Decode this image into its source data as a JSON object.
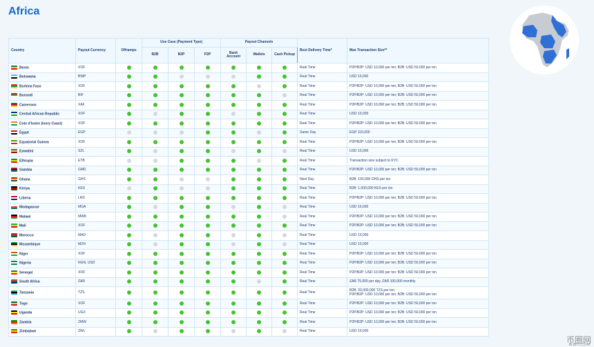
{
  "title": "Africa",
  "headers": {
    "country": "Country",
    "currency": "Payout Currency",
    "offramps": "Offramps",
    "use_case": "Use Case (Payment Type)",
    "b2b": "B2B",
    "b2p": "B2P",
    "p2p": "P2P",
    "payout_channels": "Payout Channels",
    "bank": "Bank Account",
    "wallets": "Wallets",
    "cash": "Cash Pickup",
    "delivery": "Best Delivery Time*",
    "max_txn": "Max Transaction Size**"
  },
  "status_colors": {
    "on": "#43c22f",
    "off": "#d4d8dc"
  },
  "rows": [
    {
      "country": "Benin",
      "currency": "XOF",
      "flag": [
        "#008751",
        "#fcd116",
        "#e8112d"
      ],
      "dots": [
        1,
        1,
        1,
        1,
        1,
        1,
        1
      ],
      "delivery": "Real Time",
      "max": "P2P/B2P: USD 10,000 per txn; B2B: USD 50,000 per txn"
    },
    {
      "country": "Botswana",
      "currency": "BWP",
      "flag": [
        "#75aadb",
        "#ffffff",
        "#000000"
      ],
      "dots": [
        1,
        1,
        0,
        0,
        0,
        1,
        1
      ],
      "delivery": "Real Time",
      "max": "USD 10,000"
    },
    {
      "country": "Burkina Faso",
      "currency": "XOF",
      "flag": [
        "#ef2b2d",
        "#009e49",
        "#fcd116"
      ],
      "dots": [
        1,
        1,
        1,
        1,
        1,
        0,
        1
      ],
      "delivery": "Real Time",
      "max": "P2P/B2P: USD 10,000 per txn; B2B: USD 50,000 per txn"
    },
    {
      "country": "Burundi",
      "currency": "BIF",
      "flag": [
        "#ce1126",
        "#1eb53a",
        "#ffffff"
      ],
      "dots": [
        1,
        1,
        1,
        1,
        1,
        1,
        0
      ],
      "delivery": "Real Time",
      "max": "P2P/B2P: USD 10,000 per txn; B2B: USD 50,000 per txn"
    },
    {
      "country": "Cameroon",
      "currency": "XAF",
      "flag": [
        "#007a5e",
        "#ce1126",
        "#fcd116"
      ],
      "dots": [
        1,
        1,
        1,
        1,
        1,
        1,
        1
      ],
      "delivery": "Real Time",
      "max": "P2P/B2P: USD 10,000 per txn; B2B: USD 50,000 per txn"
    },
    {
      "country": "Central African Republic",
      "currency": "XOF",
      "flag": [
        "#003082",
        "#ffffff",
        "#289728"
      ],
      "dots": [
        1,
        0,
        1,
        1,
        0,
        1,
        1
      ],
      "delivery": "Real Time",
      "max": "USD 10,000"
    },
    {
      "country": "Cote d'Ivoire (Ivory Coast)",
      "currency": "XOF",
      "flag": [
        "#f77f00",
        "#ffffff",
        "#009e60"
      ],
      "dots": [
        1,
        1,
        1,
        1,
        1,
        1,
        1
      ],
      "delivery": "Real Time",
      "max": "P2P/B2P: USD 10,000 per txn; B2B: USD 50,000 per txn"
    },
    {
      "country": "Egypt",
      "currency": "EGP",
      "flag": [
        "#ce1126",
        "#ffffff",
        "#000000"
      ],
      "dots": [
        0,
        0,
        0,
        1,
        1,
        0,
        1
      ],
      "delivery": "Same Day",
      "max": "EGP 110,000"
    },
    {
      "country": "Equatorial Guinea",
      "currency": "XOF",
      "flag": [
        "#3e9a00",
        "#ffffff",
        "#e32118"
      ],
      "dots": [
        1,
        1,
        1,
        1,
        1,
        1,
        1
      ],
      "delivery": "Real Time",
      "max": "P2P/B2P: USD 10,000 per txn; B2B: USD 50,000 per txn"
    },
    {
      "country": "Eswatini",
      "currency": "SZL",
      "flag": [
        "#3e5eb9",
        "#ffd900",
        "#b10c0c"
      ],
      "dots": [
        1,
        0,
        1,
        1,
        0,
        1,
        0
      ],
      "delivery": "Real Time",
      "max": "USD 10,000"
    },
    {
      "country": "Ethiopia",
      "currency": "ETB",
      "flag": [
        "#078930",
        "#fcdd09",
        "#da121a"
      ],
      "dots": [
        0,
        0,
        1,
        1,
        1,
        0,
        1
      ],
      "delivery": "Real Time",
      "max": "Transaction size subject to KYC"
    },
    {
      "country": "Gambia",
      "currency": "GMD",
      "flag": [
        "#ce1126",
        "#0c1c8c",
        "#3a7728"
      ],
      "dots": [
        1,
        1,
        1,
        1,
        1,
        1,
        1
      ],
      "delivery": "Real Time",
      "max": "P2P/B2P: USD 10,000 per txn; B2B: USD 50,000 per txn"
    },
    {
      "country": "Ghana",
      "currency": "GHS",
      "flag": [
        "#ce1126",
        "#fcd116",
        "#006b3f"
      ],
      "dots": [
        1,
        1,
        0,
        0,
        1,
        1,
        1
      ],
      "delivery": "Next Day",
      "max": "B2B: 100,000 GHS per txn"
    },
    {
      "country": "Kenya",
      "currency": "KES",
      "flag": [
        "#000000",
        "#bb0000",
        "#006600"
      ],
      "dots": [
        0,
        1,
        0,
        0,
        1,
        1,
        1
      ],
      "delivery": "Real Time",
      "max": "B2B: 1,000,000 KES per txn"
    },
    {
      "country": "Liberia",
      "currency": "LRD",
      "flag": [
        "#bf0a30",
        "#ffffff",
        "#002868"
      ],
      "dots": [
        1,
        1,
        1,
        1,
        1,
        1,
        1
      ],
      "delivery": "Real Time",
      "max": "P2P/B2P: USD 10,000 per txn; B2B: USD 50,000 per txn"
    },
    {
      "country": "Madagascar",
      "currency": "MGA",
      "flag": [
        "#ffffff",
        "#fc3d32",
        "#007e3a"
      ],
      "dots": [
        1,
        0,
        1,
        1,
        0,
        1,
        0
      ],
      "delivery": "Real Time",
      "max": "USD 10,000"
    },
    {
      "country": "Malawi",
      "currency": "MWK",
      "flag": [
        "#000000",
        "#ce1126",
        "#339e35"
      ],
      "dots": [
        1,
        1,
        1,
        1,
        1,
        1,
        0
      ],
      "delivery": "Real Time",
      "max": "P2P/B2P: USD 10,000 per txn; B2B: USD 50,000 per txn"
    },
    {
      "country": "Mali",
      "currency": "XOF",
      "flag": [
        "#14b53a",
        "#fcd116",
        "#ce1126"
      ],
      "dots": [
        1,
        1,
        1,
        1,
        1,
        1,
        1
      ],
      "delivery": "Real Time",
      "max": "P2P/B2P: USD 10,000 per txn; B2B: USD 50,000 per txn"
    },
    {
      "country": "Morocco",
      "currency": "MAD",
      "flag": [
        "#c1272d",
        "#c1272d",
        "#006233"
      ],
      "dots": [
        1,
        0,
        1,
        1,
        0,
        1,
        0
      ],
      "delivery": "Real Time",
      "max": "USD 10,000"
    },
    {
      "country": "Mozambique",
      "currency": "MZN",
      "flag": [
        "#009739",
        "#000000",
        "#fcd116"
      ],
      "dots": [
        1,
        0,
        1,
        1,
        0,
        1,
        0
      ],
      "delivery": "Real Time",
      "max": "USD 10,000"
    },
    {
      "country": "Niger",
      "currency": "XOF",
      "flag": [
        "#e05206",
        "#ffffff",
        "#0db02b"
      ],
      "dots": [
        1,
        1,
        1,
        1,
        1,
        1,
        1
      ],
      "delivery": "Real Time",
      "max": "P2P/B2P: USD 10,000 per txn; B2B: USD 50,000 per txn"
    },
    {
      "country": "Nigeria",
      "currency": "NGN, USD",
      "flag": [
        "#008751",
        "#ffffff",
        "#008751"
      ],
      "dots": [
        1,
        1,
        1,
        1,
        1,
        1,
        1
      ],
      "delivery": "Real Time",
      "max": "P2P/B2P: USD 10,000 per txn; B2B: USD 50,000 per txn"
    },
    {
      "country": "Senegal",
      "currency": "XOF",
      "flag": [
        "#00853f",
        "#fdef42",
        "#e31b23"
      ],
      "dots": [
        1,
        1,
        1,
        1,
        1,
        1,
        1
      ],
      "delivery": "Real Time",
      "max": "P2P/B2P: USD 10,000 per txn; B2B: USD 50,000 per txn"
    },
    {
      "country": "South Africa",
      "currency": "ZAR",
      "flag": [
        "#de3831",
        "#007a4d",
        "#002395"
      ],
      "dots": [
        1,
        1,
        1,
        1,
        1,
        0,
        1
      ],
      "delivery": "Real Time",
      "max": "ZAR 75,000 per day, ZAR 100,000 monthly"
    },
    {
      "country": "Tanzania",
      "currency": "TZS",
      "flag": [
        "#1eb53a",
        "#000000",
        "#00a3dd"
      ],
      "dots": [
        1,
        1,
        1,
        1,
        1,
        1,
        1
      ],
      "delivery": "Real Time",
      "max": "B2B: 20,000,000 TZS per txn;",
      "max2": "P2P/B2P: USD 10,000 per txn; B2B: USD 50,000 per txn",
      "tall": true
    },
    {
      "country": "Togo",
      "currency": "XOF",
      "flag": [
        "#006a4e",
        "#ffce00",
        "#d21034"
      ],
      "dots": [
        1,
        1,
        1,
        1,
        1,
        1,
        1
      ],
      "delivery": "Real Time",
      "max": "P2P/B2P: USD 10,000 per txn; B2B: USD 50,000 per txn"
    },
    {
      "country": "Uganda",
      "currency": "UGX",
      "flag": [
        "#000000",
        "#fcdc04",
        "#d90000"
      ],
      "dots": [
        1,
        1,
        1,
        1,
        1,
        1,
        1
      ],
      "delivery": "Real Time",
      "max": "P2P/B2P: USD 10,000 per txn; B2B: USD 50,000 per txn"
    },
    {
      "country": "Zambia",
      "currency": "ZMW",
      "flag": [
        "#198a00",
        "#de2010",
        "#ef7d00"
      ],
      "dots": [
        1,
        1,
        1,
        1,
        1,
        1,
        1
      ],
      "delivery": "Real Time",
      "max": "P2P/B2P: USD 10,000 per txn; B2B: USD 50,000 per txn"
    },
    {
      "country": "Zimbabwe",
      "currency": "ZWL",
      "flag": [
        "#319208",
        "#ffd200",
        "#de2010"
      ],
      "dots": [
        1,
        0,
        1,
        1,
        0,
        1,
        0
      ],
      "delivery": "Real Time",
      "max": "USD 10,000"
    }
  ],
  "watermark": {
    "name": "币圈网",
    "url": "ALIBTC.COM"
  }
}
